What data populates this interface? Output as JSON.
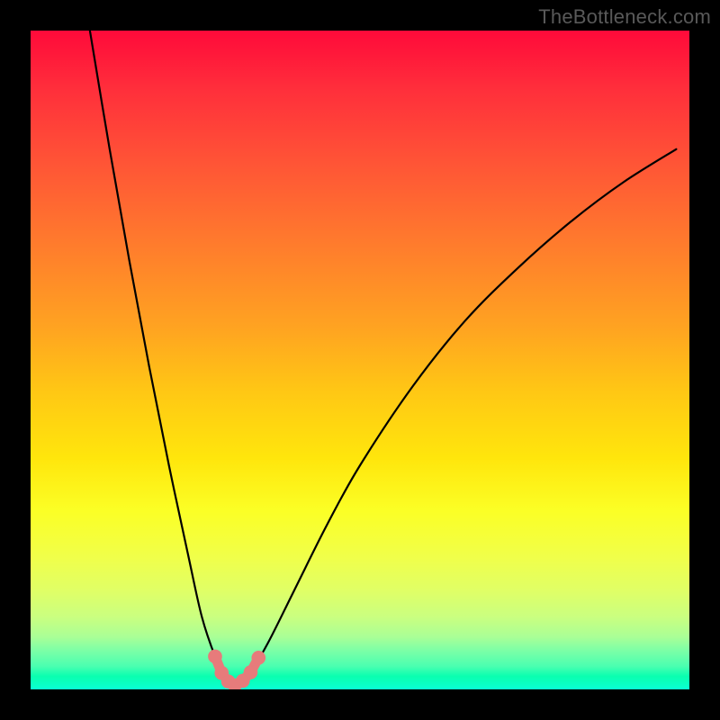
{
  "credit": "TheBottleneck.com",
  "colors": {
    "bg": "#000000",
    "dot": "#e77b7b",
    "curve": "#000000"
  },
  "chart_data": {
    "type": "line",
    "title": "",
    "xlabel": "",
    "ylabel": "",
    "xlim": [
      0,
      100
    ],
    "ylim": [
      0,
      100
    ],
    "series": [
      {
        "name": "bottleneck-curve",
        "x": [
          9,
          12,
          15,
          18,
          21,
          24,
          26,
          28,
          29.5,
          31,
          33,
          36,
          40,
          45,
          50,
          58,
          66,
          74,
          82,
          90,
          98
        ],
        "y": [
          100,
          82,
          65,
          49,
          34,
          20,
          11,
          5,
          2,
          0.5,
          2,
          7,
          15,
          25,
          34,
          46,
          56,
          64,
          71,
          77,
          82
        ]
      }
    ],
    "highlight_dots": {
      "name": "trough-dots",
      "x": [
        28.0,
        29.0,
        30.0,
        31.0,
        32.2,
        33.4,
        34.6
      ],
      "y": [
        5.0,
        2.5,
        1.2,
        0.6,
        1.3,
        2.6,
        4.8
      ]
    },
    "gradient_background": {
      "top": "#ff0a3a",
      "bottom": "#0affd6",
      "direction": "vertical",
      "note": "red→orange→yellow→green spectrum fill behind curve"
    }
  }
}
